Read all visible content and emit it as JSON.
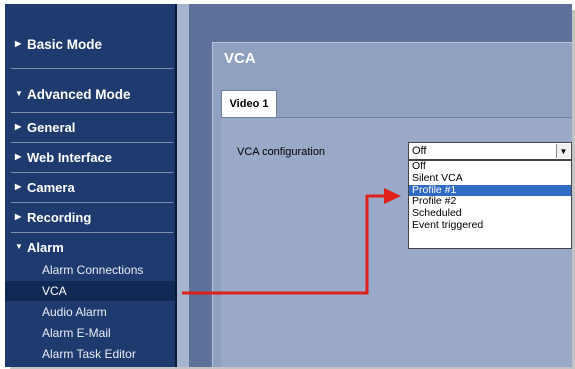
{
  "sidebar": {
    "basic_mode": "Basic Mode",
    "advanced_mode": "Advanced Mode",
    "items": {
      "general": "General",
      "web_interface": "Web Interface",
      "camera": "Camera",
      "recording": "Recording",
      "alarm": "Alarm"
    },
    "alarm_sub": {
      "connections": "Alarm Connections",
      "vca": "VCA",
      "audio": "Audio Alarm",
      "email": "Alarm E-Mail",
      "task_editor": "Alarm Task Editor"
    },
    "icons": {
      "collapsed": "▶",
      "expanded": "▼"
    }
  },
  "page": {
    "title": "VCA",
    "tab": "Video 1",
    "vca_config_label": "VCA configuration",
    "select_value": "Off",
    "select_arrow": "▼",
    "options": {
      "off": "Off",
      "silent": "Silent VCA",
      "profile1": "Profile #1",
      "profile2": "Profile #2",
      "scheduled": "Scheduled",
      "event": "Event triggered"
    }
  },
  "colors": {
    "sidebar": "#1f3a6f",
    "content": "#5d719b",
    "highlight": "#316ac5",
    "annotation_arrow": "#e0201b"
  }
}
